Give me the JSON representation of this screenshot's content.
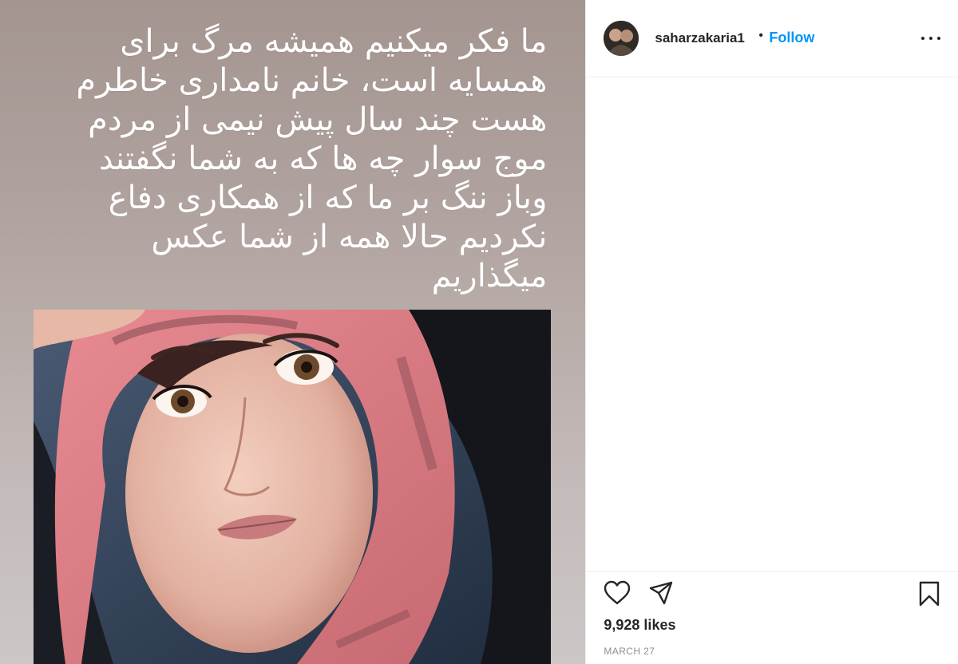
{
  "post": {
    "overlay_text": "ما فکر میکنیم همیشه مرگ برای\nهمسایه است، خانم نامداری خاطرم\nهست چند سال پیش نیمی از مردم\nموج سوار چه ها که به شما نگفتند\nوباز ننگ بر ما که از همکاری دفاع\nنکردیم حالا همه از شما عکس\nمیگذاریم"
  },
  "header": {
    "username": "saharzakaria1",
    "separator": "•",
    "follow_label": "Follow"
  },
  "icons": {
    "more": "more-options-icon",
    "like": "heart-icon",
    "share": "share-icon",
    "save": "bookmark-icon"
  },
  "stats": {
    "likes": "9,928 likes",
    "date": "MARCH 27"
  },
  "colors": {
    "follow_blue": "#0095f6",
    "text_primary": "#262626",
    "text_secondary": "#8e8e8e",
    "divider": "#efefef"
  }
}
